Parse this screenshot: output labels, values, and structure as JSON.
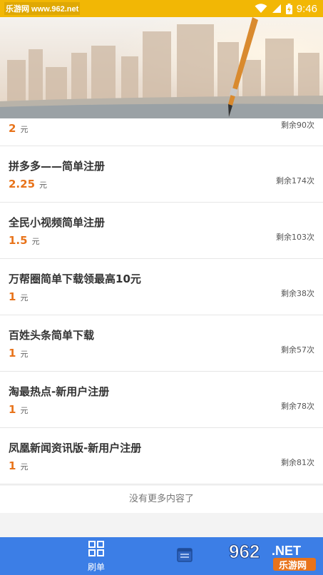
{
  "status_bar": {
    "watermark": "乐游网 www.962.net",
    "time": "9:46"
  },
  "items": [
    {
      "title": "",
      "price": "2",
      "unit": "元",
      "remaining": "剩余90次"
    },
    {
      "title": "拼多多——简单注册",
      "price": "2.25",
      "unit": "元",
      "remaining": "剩余174次"
    },
    {
      "title": "全民小视频简单注册",
      "price": "1.5",
      "unit": "元",
      "remaining": "剩余103次"
    },
    {
      "title": "万帮圈简单下载领最高10元",
      "price": "1",
      "unit": "元",
      "remaining": "剩余38次"
    },
    {
      "title": "百姓头条简单下载",
      "price": "1",
      "unit": "元",
      "remaining": "剩余57次"
    },
    {
      "title": "淘最热点-新用户注册",
      "price": "1",
      "unit": "元",
      "remaining": "剩余78次"
    },
    {
      "title": "凤凰新闻资讯版-新用户注册",
      "price": "1",
      "unit": "元",
      "remaining": "剩余81次"
    }
  ],
  "footer_text": "没有更多内容了",
  "bottom_nav": {
    "tab1_label": "刷单",
    "logo_text_1": "962",
    "logo_text_2": ".NET",
    "logo_text_3": "乐游网"
  },
  "colors": {
    "status_bar": "#f2b705",
    "accent_price": "#e8731a",
    "nav_bar": "#3c7ee6"
  },
  "icons": {
    "wifi": "wifi-icon",
    "signal": "signal-icon",
    "battery": "battery-charging-icon",
    "tab1": "grid-icon",
    "tab2": "list-card-icon"
  }
}
